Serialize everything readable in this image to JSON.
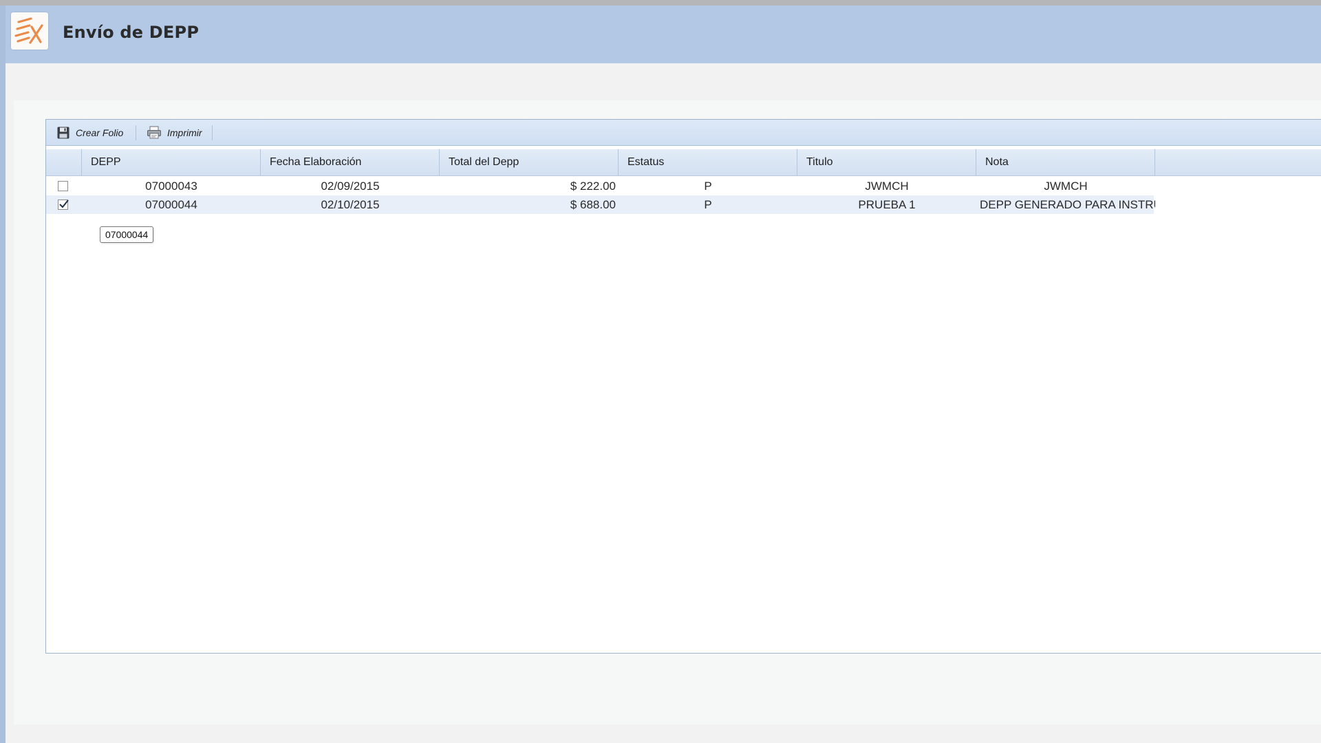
{
  "app": {
    "title": "Envío de DEPP",
    "logo_icon": "ex-logo-icon"
  },
  "toolbar": {
    "buttons": [
      {
        "label": "Crear Folio",
        "icon": "save-icon"
      },
      {
        "label": "Imprimir",
        "icon": "printer-icon"
      }
    ]
  },
  "table": {
    "columns": [
      "DEPP",
      "Fecha Elaboración",
      "Total del Depp",
      "Estatus",
      "Titulo",
      "Nota"
    ],
    "rows": [
      {
        "checked": false,
        "depp": "07000043",
        "fecha": "02/09/2015",
        "total": "$ 222.00",
        "estatus": "P",
        "titulo": "JWMCH",
        "nota": "JWMCH"
      },
      {
        "checked": true,
        "depp": "07000044",
        "fecha": "02/10/2015",
        "total": "$ 688.00",
        "estatus": "P",
        "titulo": "PRUEBA 1",
        "nota": "DEPP GENERADO PARA INSTRU"
      }
    ]
  },
  "tooltip": {
    "text": "07000044"
  },
  "colors": {
    "header_bg": "#b3c8e5",
    "selected_row": "#e8eff9",
    "logo_accent": "#e98b4a"
  }
}
